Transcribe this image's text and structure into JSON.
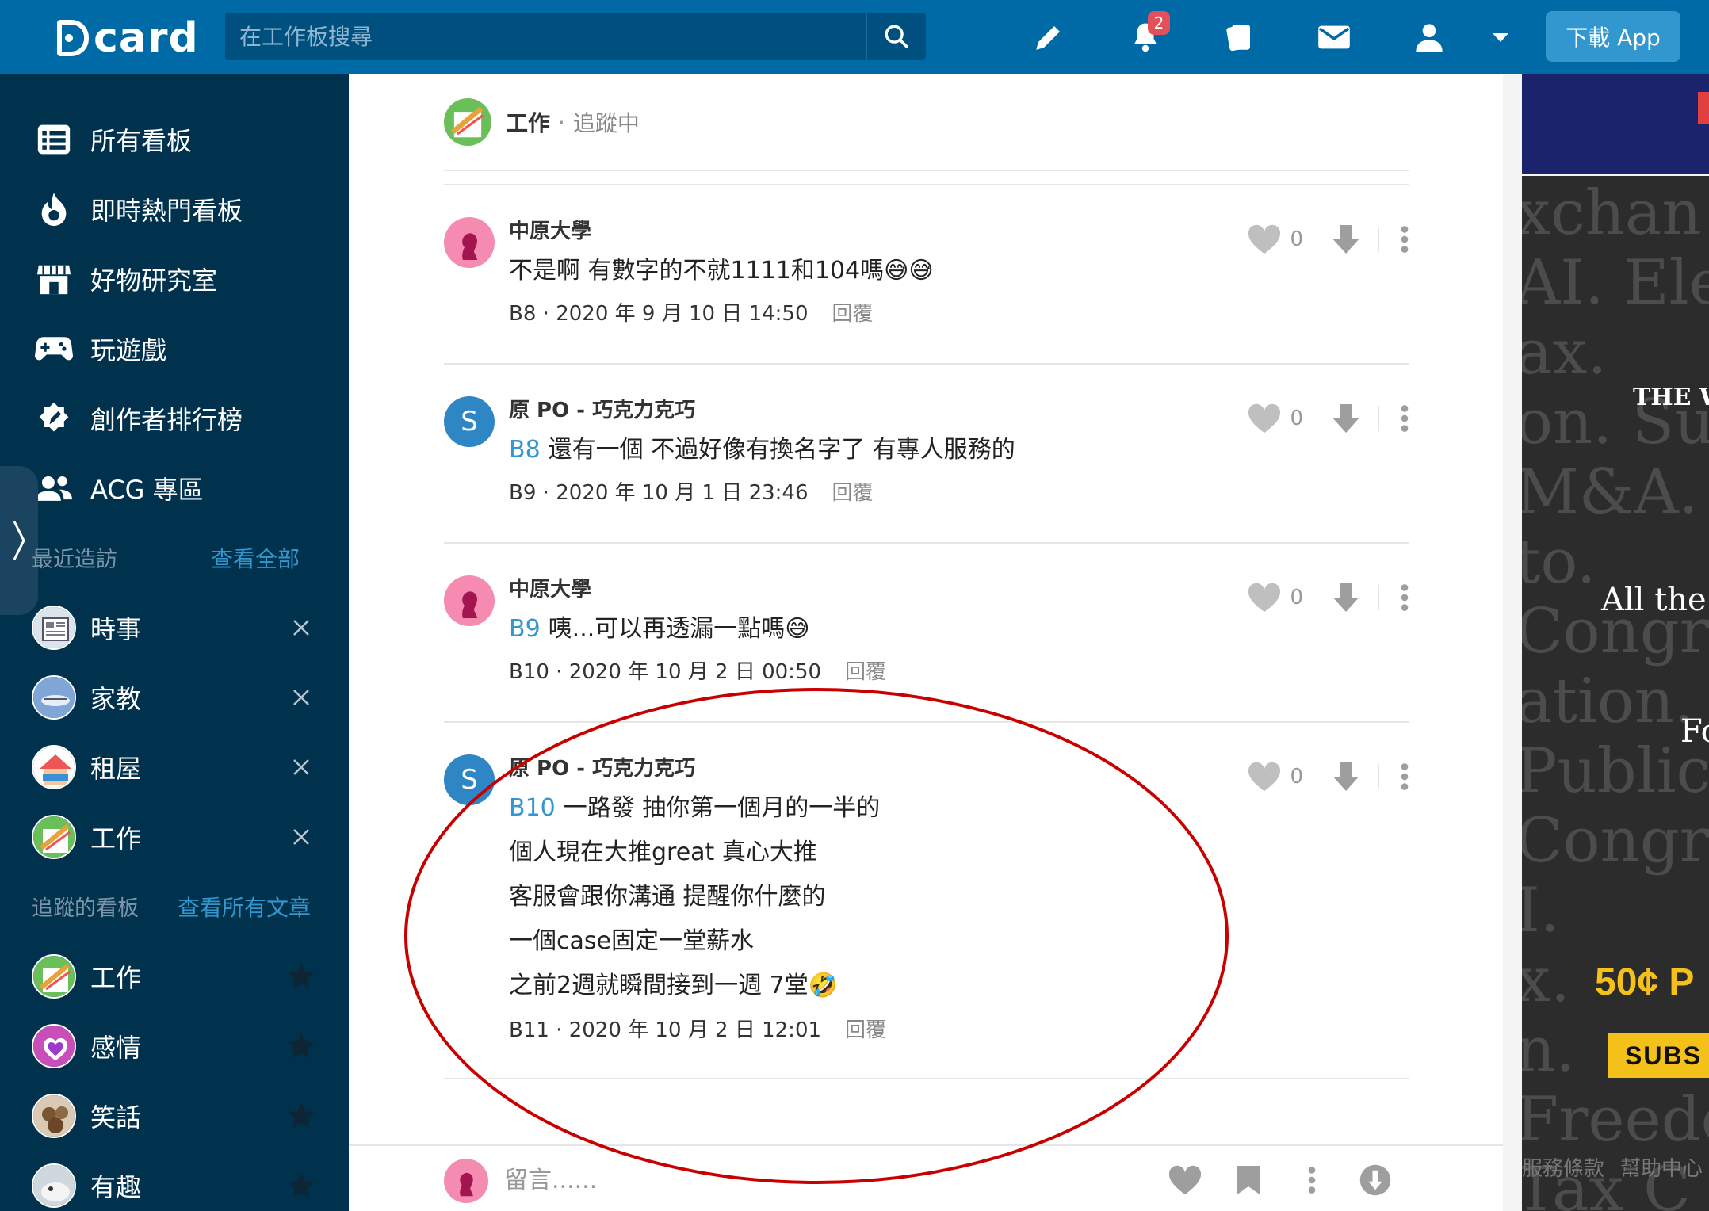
{
  "header": {
    "logo_text": "card",
    "search_placeholder": "在工作板搜尋",
    "notifications_count": "2",
    "download_label": "下載 App",
    "icons": [
      "search-icon",
      "pencil-icon",
      "bell-icon",
      "cards-icon",
      "mail-icon",
      "user-icon",
      "caret-down-icon"
    ]
  },
  "sidebar": {
    "nav": [
      {
        "label": "所有看板",
        "icon": "list-icon"
      },
      {
        "label": "即時熱門看板",
        "icon": "flame-icon"
      },
      {
        "label": "好物研究室",
        "icon": "store-icon"
      },
      {
        "label": "玩遊戲",
        "icon": "gamepad-icon"
      },
      {
        "label": "創作者排行榜",
        "icon": "pen-badge-icon"
      },
      {
        "label": "ACG 專區",
        "icon": "people-icon"
      }
    ],
    "recent": {
      "title": "最近造訪",
      "link": "查看全部",
      "items": [
        {
          "label": "時事"
        },
        {
          "label": "家教"
        },
        {
          "label": "租屋"
        },
        {
          "label": "工作"
        }
      ]
    },
    "followed": {
      "title": "追蹤的看板",
      "link": "查看所有文章",
      "items": [
        {
          "label": "工作"
        },
        {
          "label": "感情"
        },
        {
          "label": "笑話"
        },
        {
          "label": "有趣"
        }
      ]
    }
  },
  "forum": {
    "name": "工作",
    "separator": "·",
    "status": "追蹤中"
  },
  "comments": [
    {
      "author": "中原大學",
      "lines": [
        {
          "ref": "",
          "text": "不是啊 有數字的不就1111和104嗎😅😅"
        }
      ],
      "floor": "B8",
      "date": "2020 年 9 月 10 日 14:50",
      "reply": "回覆",
      "likes": "0"
    },
    {
      "author": "原 PO - 巧克力克巧",
      "lines": [
        {
          "ref": "B8",
          "text": "還有一個 不過好像有換名字了 有專人服務的"
        }
      ],
      "floor": "B9",
      "date": "2020 年 10 月 1 日 23:46",
      "reply": "回覆",
      "likes": "0"
    },
    {
      "author": "中原大學",
      "lines": [
        {
          "ref": "B9",
          "text": "咦...可以再透漏一點嗎😅"
        }
      ],
      "floor": "B10",
      "date": "2020 年 10 月 2 日 00:50",
      "reply": "回覆",
      "likes": "0"
    },
    {
      "author": "原 PO - 巧克力克巧",
      "lines": [
        {
          "ref": "B10",
          "text": "一路發 抽你第一個月的一半的"
        },
        {
          "ref": "",
          "text": "個人現在大推great 真心大推"
        },
        {
          "ref": "",
          "text": "客服會跟你溝通 提醒你什麼的"
        },
        {
          "ref": "",
          "text": "一個case固定一堂薪水"
        },
        {
          "ref": "",
          "text": "之前2週就瞬間接到一週 7堂🤣"
        }
      ],
      "floor": "B11",
      "date": "2020 年 10 月 2 日 12:01",
      "reply": "回覆",
      "likes": "0"
    }
  ],
  "comment_bar": {
    "placeholder": "留言......"
  },
  "ad": {
    "serif_lines": [
      "xchan",
      "AI. Ele",
      "ax.",
      "on. Sus",
      "M&A.",
      "to.",
      "Congre",
      "ation.",
      "Public",
      "Congre",
      "I.",
      "x.",
      "n.",
      "Freedo",
      "Tax C"
    ],
    "masthead": "THE WAI",
    "tagline": "All the I",
    "fo": "Fo",
    "price": "50¢ P",
    "subscribe": "SUBS",
    "footer": [
      "服務條款",
      "幫助中心"
    ]
  },
  "colors": {
    "brand": "#006aa6",
    "sidebar": "#00324e",
    "link": "#3397cf",
    "annotation": "#c80000"
  }
}
